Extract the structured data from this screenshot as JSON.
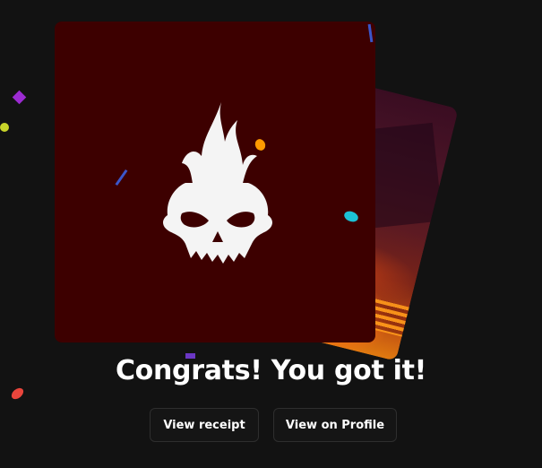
{
  "dialog": {
    "title": "Congrats! You got it!",
    "buttons": {
      "view_receipt": "View receipt",
      "view_on_profile": "View on Profile"
    }
  },
  "cards": {
    "front": {
      "icon": "flaming-skull-icon",
      "background": "#3d0000"
    },
    "back": {
      "icon": "fire-artwork"
    }
  },
  "colors": {
    "background": "#121212",
    "text": "#ffffff",
    "button_bg": "#151515",
    "button_border": "#2e2e2e"
  }
}
